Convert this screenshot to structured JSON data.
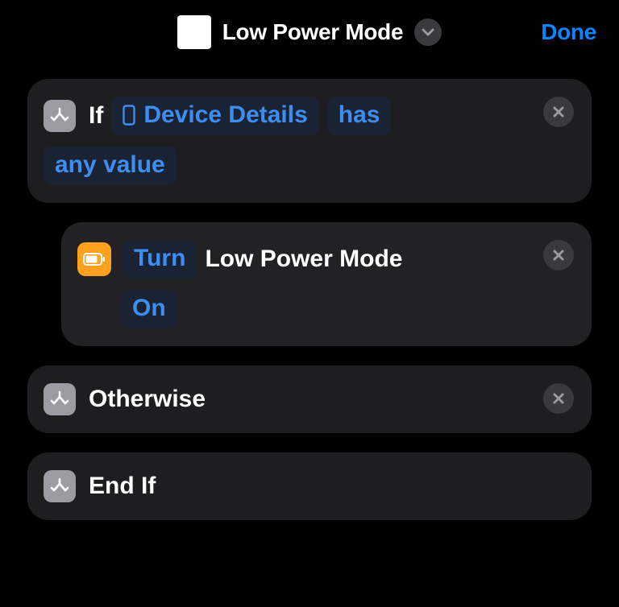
{
  "header": {
    "title": "Low Power Mode",
    "done_label": "Done"
  },
  "blocks": {
    "if": {
      "keyword": "If",
      "variable": "Device Details",
      "condition": "has",
      "qualifier": "any value"
    },
    "action": {
      "verb": "Turn",
      "subject": "Low Power Mode",
      "state": "On"
    },
    "otherwise": {
      "keyword": "Otherwise"
    },
    "endif": {
      "keyword": "End If"
    }
  }
}
